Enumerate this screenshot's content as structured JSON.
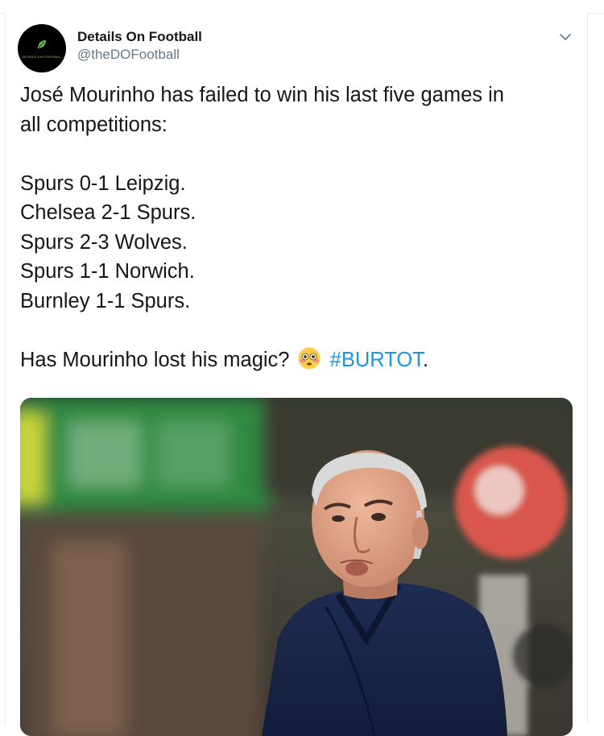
{
  "tweet": {
    "author_name": "Details On Football",
    "author_handle": "@theDOFootball",
    "avatar_text": "DETAILS ON FOOTBALL",
    "lines": {
      "intro_1": "José Mourinho has failed to win his last five games in",
      "intro_2": "all competitions:",
      "result_1": "Spurs 0-1 Leipzig.",
      "result_2": "Chelsea 2-1 Spurs.",
      "result_3": "Spurs 2-3 Wolves.",
      "result_4": "Spurs 1-1 Norwich.",
      "result_5": "Burnley 1-1 Spurs.",
      "question": "Has Mourinho lost his magic?",
      "hashtag": "#BURTOT",
      "trailing_punct": "."
    },
    "icons": {
      "menu": "chevron-down-icon",
      "emoji": "flushed-face-emoji"
    },
    "colors": {
      "link": "#1b95e0",
      "secondary_text": "#657786",
      "text": "#14171a",
      "border": "#e6ecf0"
    }
  }
}
